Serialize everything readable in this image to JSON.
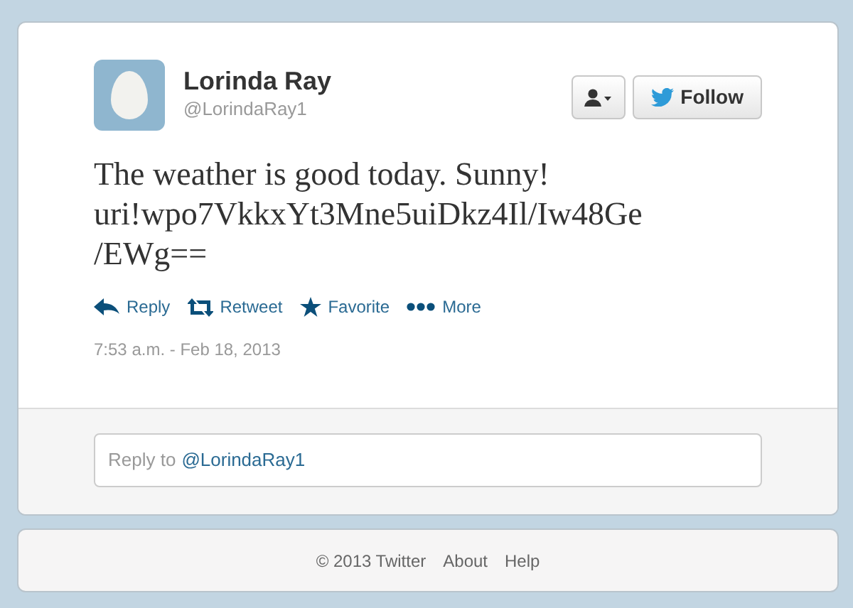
{
  "tweet": {
    "name": "Lorinda Ray",
    "handle": "@LorindaRay1",
    "follow_button": "Follow",
    "text_lines": [
      "The weather is good today. Sunny!",
      "uri!wpo7VkkxYt3Mne5uiDkz4Il/Iw48Ge",
      "/EWg=="
    ],
    "actions": [
      {
        "kind": "reply",
        "label": "Reply"
      },
      {
        "kind": "retweet",
        "label": "Retweet"
      },
      {
        "kind": "favorite",
        "label": "Favorite"
      },
      {
        "kind": "more",
        "label": "More"
      }
    ],
    "timestamp": "7:53 a.m. - Feb 18, 2013"
  },
  "reply": {
    "placeholder": "Reply to",
    "mention": "@LorindaRay1"
  },
  "footer": {
    "copyright": "© 2013 Twitter",
    "links": [
      "About",
      "Help"
    ]
  }
}
